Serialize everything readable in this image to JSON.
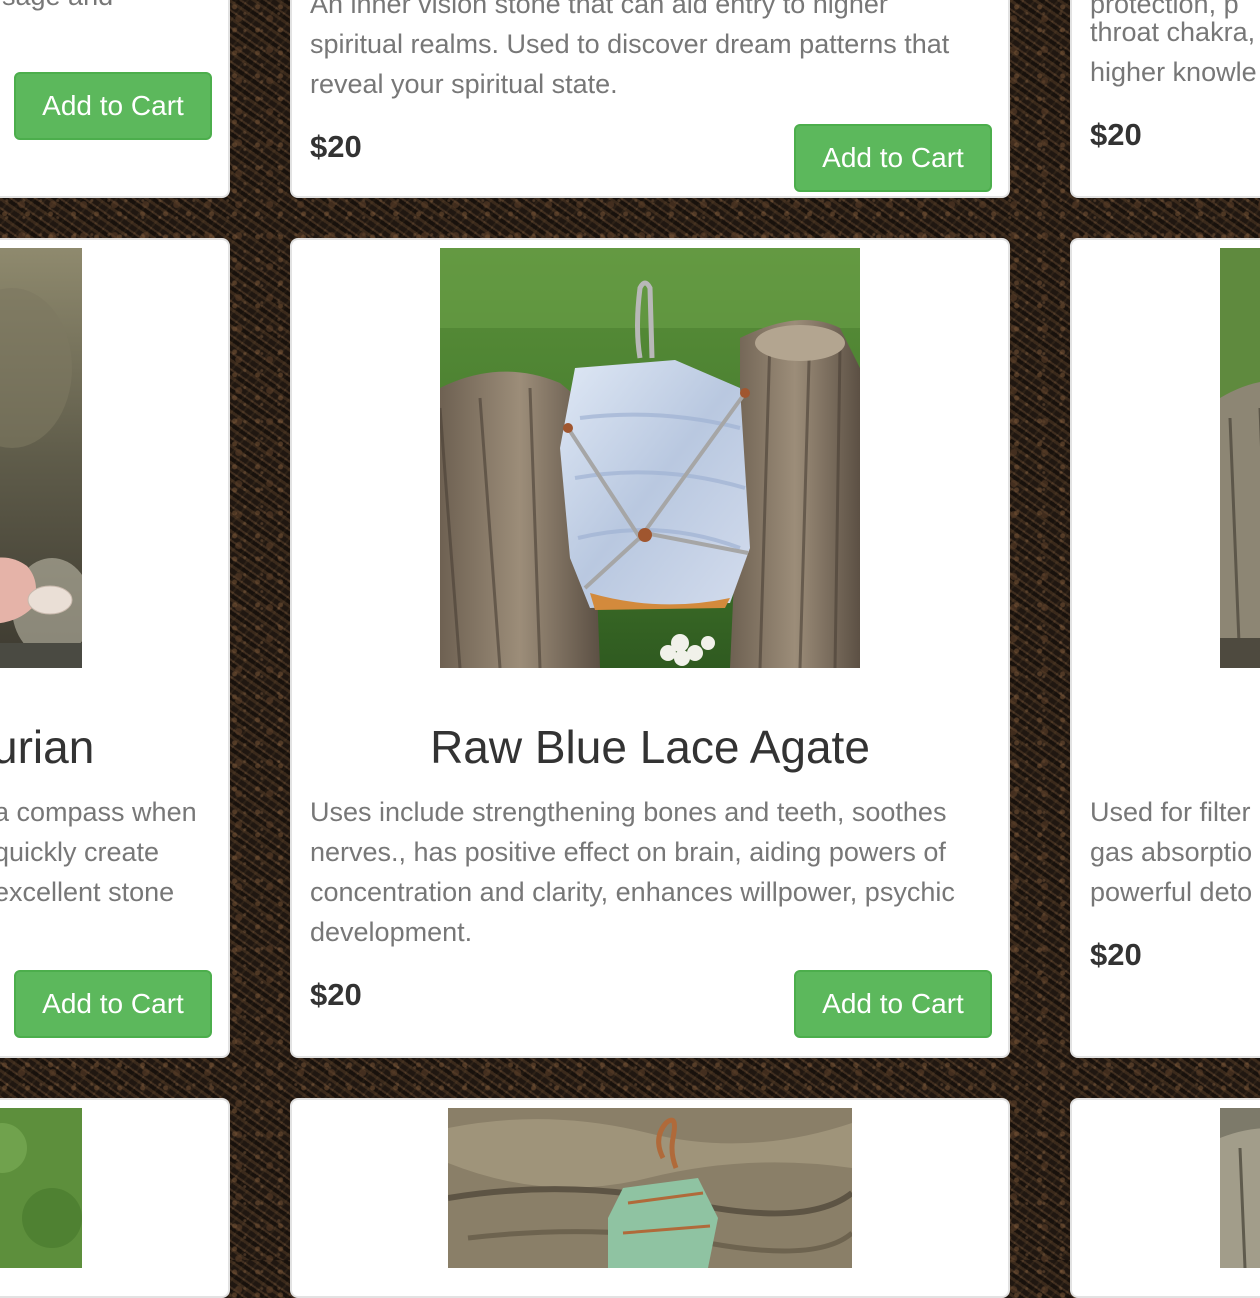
{
  "products": {
    "top_left": {
      "description_fragment": "sage and",
      "button_label": "Add to Cart"
    },
    "top_center": {
      "description_lines": [
        "An inner vision stone that can aid entry to higher",
        "spiritual realms. Used to discover dream patterns that",
        "reveal your spiritual state."
      ],
      "price": "$20",
      "button_label": "Add to Cart"
    },
    "top_right": {
      "description_lines": [
        "protection, p",
        "throat chakra,",
        "higher knowle"
      ],
      "price": "$20"
    },
    "middle_left": {
      "title_fragment": "urian",
      "description_lines": [
        "a compass when",
        "quickly create",
        "excellent stone"
      ],
      "button_label": "Add to Cart"
    },
    "middle_center": {
      "title": "Raw Blue Lace Agate",
      "description_lines": [
        "Uses include strengthening bones and teeth, soothes",
        "nerves., has positive effect on brain, aiding powers of",
        "concentration and clarity, enhances willpower, psychic",
        "development."
      ],
      "price": "$20",
      "button_label": "Add to Cart"
    },
    "middle_right": {
      "description_lines": [
        "Used for filter",
        "gas absorptio",
        "powerful deto"
      ],
      "price": "$20"
    }
  }
}
